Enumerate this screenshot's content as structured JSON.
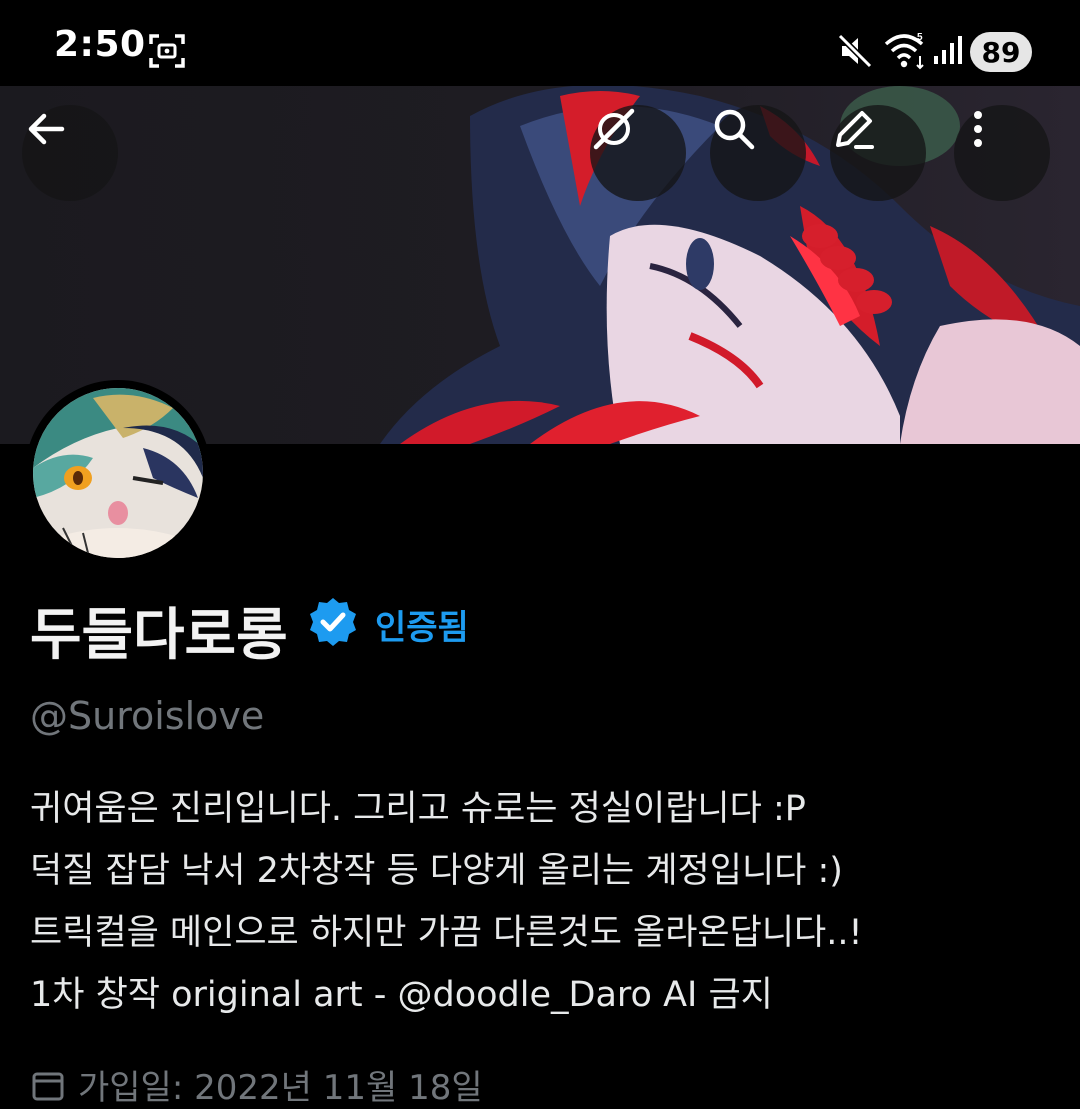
{
  "status_bar": {
    "time": "2:50",
    "battery": "89",
    "icons": [
      "screen-record-icon",
      "mute-icon",
      "wifi-icon",
      "signal-icon"
    ]
  },
  "header": {
    "buttons": [
      "back-arrow-icon",
      "grok-icon",
      "search-icon",
      "edit-icon",
      "more-vertical-icon"
    ]
  },
  "profile": {
    "display_name": "두들다로롱",
    "verified_label": "인증됨",
    "handle": "@Suroislove",
    "bio_lines": [
      "귀여움은 진리입니다. 그리고 슈로는 정실이랍니다 :P",
      "덕질 잡담 낙서 2차창작 등 다양게 올리는 계정입니다 :)",
      "트릭컬을 메인으로 하지만 가끔 다른것도 올라온답니다..!",
      "1차 창작 original art - @doodle_Daro AI 금지"
    ],
    "joined_text": "가입일: 2022년 11월 18일"
  },
  "colors": {
    "background": "#000000",
    "verified_blue": "#1d9bf0",
    "secondary_text": "#71767b",
    "primary_text": "#e7e9ea"
  }
}
